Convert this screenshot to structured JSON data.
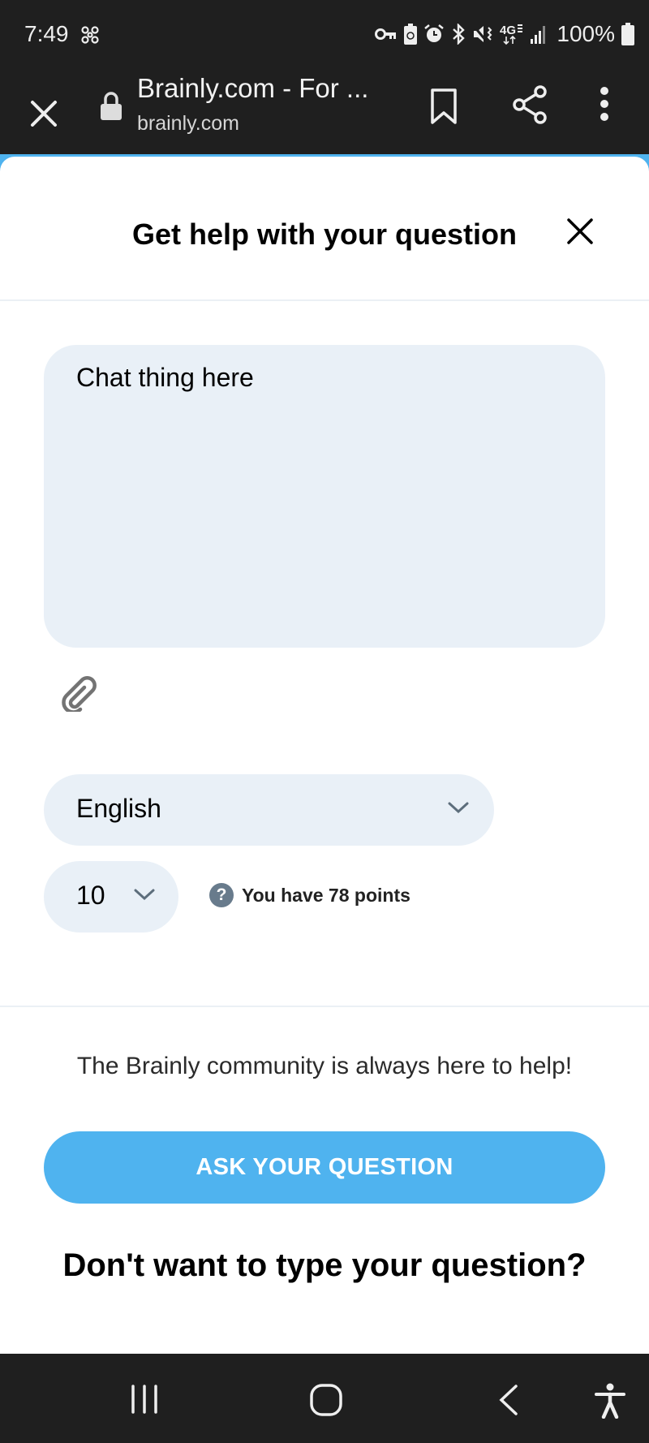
{
  "status_bar": {
    "time": "7:49",
    "left_icons": [
      "fan-icon"
    ],
    "right_icons": [
      "vpn-key-icon",
      "battery-saver-icon",
      "alarm-icon",
      "bluetooth-icon",
      "mute-vibrate-icon",
      "4g-lte-icon",
      "signal-icon"
    ],
    "battery_percent": "100%"
  },
  "browser": {
    "page_title": "Brainly.com - For ...",
    "url": "brainly.com",
    "actions": [
      "close",
      "bookmark",
      "share",
      "more-options"
    ]
  },
  "modal": {
    "title": "Get help with your question",
    "question_input": {
      "value": "Chat thing here",
      "placeholder": ""
    },
    "attach_label": "Attach file",
    "language_select": {
      "selected": "English"
    },
    "points_select": {
      "selected": "10"
    },
    "points_info": "You have 78 points",
    "community_text": "The Brainly community is always here to help!",
    "ask_button": "ASK YOUR QUESTION",
    "dont_type_heading": "Don't want to type your question?"
  },
  "colors": {
    "accent": "#4fb3ef",
    "input_bg": "#e9f0f7",
    "system_bar": "#1f1f1f",
    "help_icon": "#687b8c"
  },
  "nav_bar": {
    "buttons": [
      "recent-apps",
      "home",
      "back",
      "accessibility"
    ]
  }
}
